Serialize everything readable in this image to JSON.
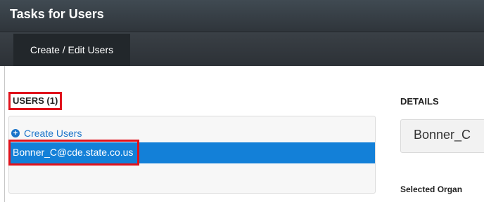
{
  "header": {
    "title": "Tasks for Users"
  },
  "nav": {
    "tabs": [
      {
        "label": "Create / Edit Users"
      }
    ]
  },
  "users": {
    "heading": "USERS (1)",
    "create_label": "Create Users",
    "items": [
      {
        "email": "Bonner_C@cde.state.co.us"
      }
    ]
  },
  "details": {
    "heading": "DETAILS",
    "name_value": "Bonner_C",
    "selected_org_label": "Selected Organ"
  },
  "colors": {
    "accent": "#1380d8",
    "link": "#1a73c9",
    "highlight_border": "#e0121b",
    "topbar": "#3a4249"
  }
}
